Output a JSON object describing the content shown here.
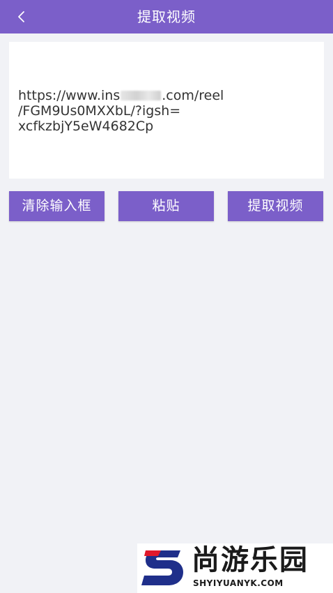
{
  "header": {
    "title": "提取视频",
    "back_icon": "chevron-left-icon",
    "background_color": "#7b5fc9"
  },
  "url_input": {
    "line1_before": "https://www.ins",
    "line1_after": ".com/reel",
    "line2": "/FGM9Us0MXXbL/?igsh=",
    "line3": "xcfkzbjY5eW4682Cp"
  },
  "buttons": {
    "clear_label": "清除输入框",
    "paste_label": "粘贴",
    "extract_label": "提取视频",
    "color": "#7b5fc9"
  },
  "watermark": {
    "brand_cn": "尚游乐园",
    "brand_en": "SHYIYUANYK.COM",
    "logo_colors": {
      "primary": "#1f2f8a",
      "accent": "#e0182b"
    }
  }
}
